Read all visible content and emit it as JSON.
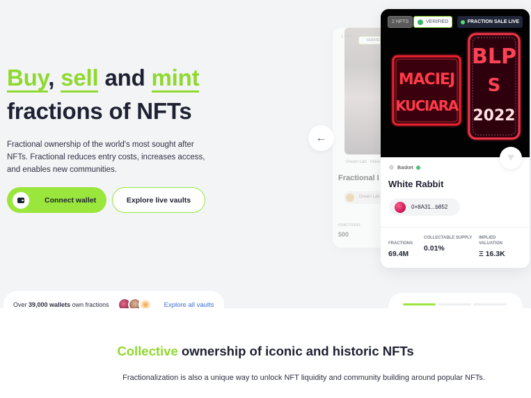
{
  "hero": {
    "headline": {
      "w1": "Buy",
      "sep1": ",",
      "w2": "sell",
      "and": "and",
      "w3": "mint",
      "line2": "fractions of NFTs"
    },
    "description": "Fractional ownership of the world's most sought after NFTs. Fractional reduces entry costs, increases access, and enables new communities.",
    "connect_button": "Connect wallet",
    "explore_button": "Explore live vaults",
    "owners": {
      "prefix": "Over",
      "count": "39,000 wallets",
      "suffix": "own fractions",
      "link": "Explore all vaults"
    },
    "prev_arrow": "←"
  },
  "back_card": {
    "tag": "1 NFT",
    "verified": "VERIFIED",
    "caption": "Dream Lab · Initial",
    "title": "Fractional I",
    "owner": "Dream Lab",
    "fractions_label": "FRACTIONS",
    "fractions_value": "500"
  },
  "featured_card": {
    "badge_count": "2 NFTS",
    "badge_verified": "VERIFIED",
    "badge_status": "FRACTION SALE LIVE",
    "art_text_left": "MACIEJ KUCIARA",
    "art_text_right_1": "BLP",
    "art_text_right_2": "2022",
    "type": "Basket",
    "title": "White Rabbit",
    "address": "0×8A31...b852",
    "stats": [
      {
        "label": "FRACTIONS",
        "value": "69.4M"
      },
      {
        "label": "COLLECTABLE SUPPLY",
        "value": "0.01%"
      },
      {
        "label": "IMPLIED VALUATION",
        "value": "Ξ 16.3K"
      }
    ],
    "heart_icon": "heart-icon"
  },
  "slider": {
    "active_index": 0,
    "count": 3
  },
  "section": {
    "title_highlight": "Collective",
    "title_rest": "ownership of iconic and historic NFTs",
    "subtitle": "Fractionalization is also a unique way to unlock NFT liquidity and community building around popular NFTs."
  },
  "colors": {
    "accent": "#9ae63c",
    "dark": "#1d2131",
    "link": "#3b6fd6",
    "hero_bg": "#f3f4f6"
  }
}
